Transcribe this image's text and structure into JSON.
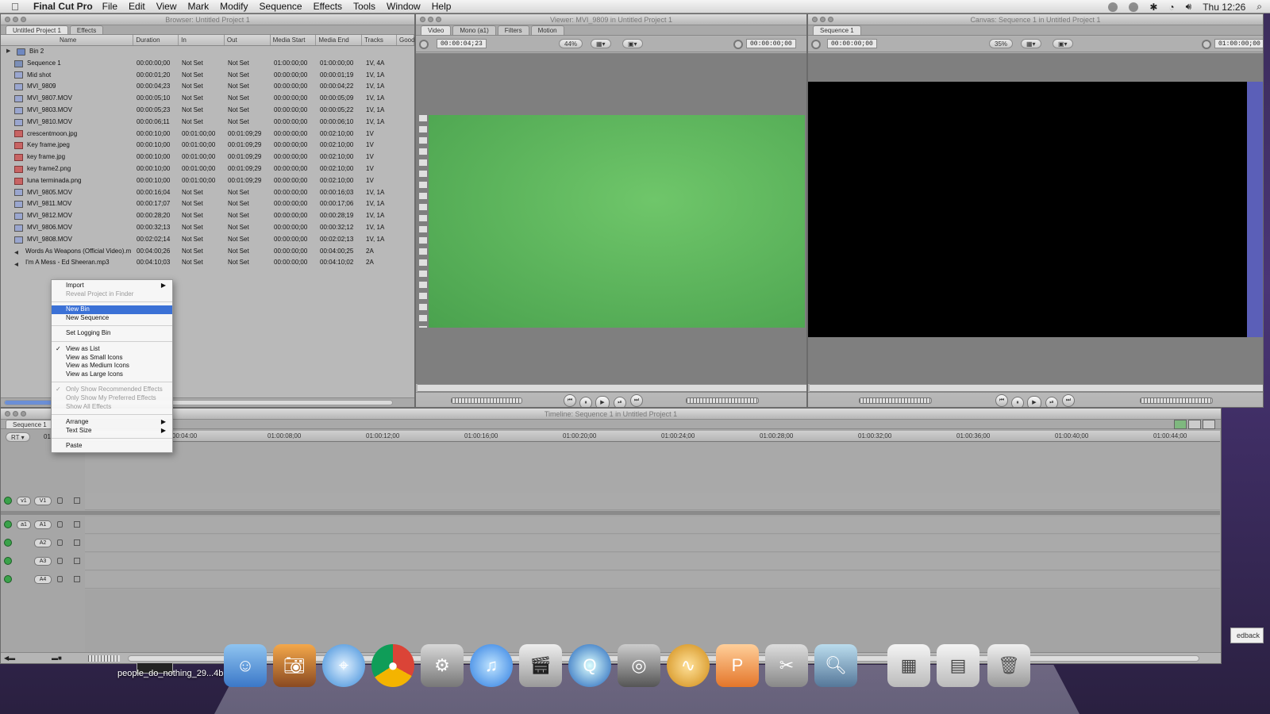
{
  "menubar": {
    "app_name": "Final Cut Pro",
    "menus": [
      "File",
      "Edit",
      "View",
      "Mark",
      "Modify",
      "Sequence",
      "Effects",
      "Tools",
      "Window",
      "Help"
    ],
    "clock": "Thu 12:26"
  },
  "browser": {
    "title": "Browser: Untitled Project 1",
    "tabs": [
      "Untitled Project 1",
      "Effects"
    ],
    "columns": [
      "Name",
      "Duration",
      "In",
      "Out",
      "Media Start",
      "Media End",
      "Tracks",
      "Good"
    ],
    "rows": [
      {
        "name": "Bin 2",
        "type": "bin",
        "duration": "",
        "in": "",
        "out": "",
        "media_start": "",
        "media_end": "",
        "tracks": ""
      },
      {
        "name": "Sequence 1",
        "type": "seq",
        "duration": "00:00:00;00",
        "in": "Not Set",
        "out": "Not Set",
        "media_start": "01:00:00;00",
        "media_end": "01:00:00;00",
        "tracks": "1V, 4A"
      },
      {
        "name": "Mid shot",
        "type": "clip",
        "duration": "00:00:01;20",
        "in": "Not Set",
        "out": "Not Set",
        "media_start": "00:00:00;00",
        "media_end": "00:00:01;19",
        "tracks": "1V, 1A"
      },
      {
        "name": "MVI_9809",
        "type": "clip",
        "duration": "00:00:04;23",
        "in": "Not Set",
        "out": "Not Set",
        "media_start": "00:00:00;00",
        "media_end": "00:00:04;22",
        "tracks": "1V, 1A"
      },
      {
        "name": "MVI_9807.MOV",
        "type": "clip",
        "duration": "00:00:05;10",
        "in": "Not Set",
        "out": "Not Set",
        "media_start": "00:00:00;00",
        "media_end": "00:00:05;09",
        "tracks": "1V, 1A"
      },
      {
        "name": "MVI_9803.MOV",
        "type": "clip",
        "duration": "00:00:05;23",
        "in": "Not Set",
        "out": "Not Set",
        "media_start": "00:00:00;00",
        "media_end": "00:00:05;22",
        "tracks": "1V, 1A"
      },
      {
        "name": "MVI_9810.MOV",
        "type": "clip",
        "duration": "00:00:06;11",
        "in": "Not Set",
        "out": "Not Set",
        "media_start": "00:00:00;00",
        "media_end": "00:00:06;10",
        "tracks": "1V, 1A"
      },
      {
        "name": "crescentmoon.jpg",
        "type": "img",
        "duration": "00:00:10;00",
        "in": "00:01:00;00",
        "out": "00:01:09;29",
        "media_start": "00:00:00;00",
        "media_end": "00:02:10;00",
        "tracks": "1V"
      },
      {
        "name": "Key frame.jpeg",
        "type": "img",
        "duration": "00:00:10;00",
        "in": "00:01:00;00",
        "out": "00:01:09;29",
        "media_start": "00:00:00;00",
        "media_end": "00:02:10;00",
        "tracks": "1V"
      },
      {
        "name": "key frame.jpg",
        "type": "img",
        "duration": "00:00:10;00",
        "in": "00:01:00;00",
        "out": "00:01:09;29",
        "media_start": "00:00:00;00",
        "media_end": "00:02:10;00",
        "tracks": "1V"
      },
      {
        "name": "key frame2.png",
        "type": "img",
        "duration": "00:00:10;00",
        "in": "00:01:00;00",
        "out": "00:01:09;29",
        "media_start": "00:00:00;00",
        "media_end": "00:02:10;00",
        "tracks": "1V"
      },
      {
        "name": "luna terminada.png",
        "type": "img",
        "duration": "00:00:10;00",
        "in": "00:01:00;00",
        "out": "00:01:09;29",
        "media_start": "00:00:00;00",
        "media_end": "00:02:10;00",
        "tracks": "1V"
      },
      {
        "name": "MVI_9805.MOV",
        "type": "clip",
        "duration": "00:00:16;04",
        "in": "Not Set",
        "out": "Not Set",
        "media_start": "00:00:00;00",
        "media_end": "00:00:16;03",
        "tracks": "1V, 1A"
      },
      {
        "name": "MVI_9811.MOV",
        "type": "clip",
        "duration": "00:00:17;07",
        "in": "Not Set",
        "out": "Not Set",
        "media_start": "00:00:00;00",
        "media_end": "00:00:17;06",
        "tracks": "1V, 1A"
      },
      {
        "name": "MVI_9812.MOV",
        "type": "clip",
        "duration": "00:00:28;20",
        "in": "Not Set",
        "out": "Not Set",
        "media_start": "00:00:00;00",
        "media_end": "00:00:28;19",
        "tracks": "1V, 1A"
      },
      {
        "name": "MVI_9806.MOV",
        "type": "clip",
        "duration": "00:00:32;13",
        "in": "Not Set",
        "out": "Not Set",
        "media_start": "00:00:00;00",
        "media_end": "00:00:32;12",
        "tracks": "1V, 1A"
      },
      {
        "name": "MVI_9808.MOV",
        "type": "clip",
        "duration": "00:02:02;14",
        "in": "Not Set",
        "out": "Not Set",
        "media_start": "00:00:00;00",
        "media_end": "00:02:02;13",
        "tracks": "1V, 1A"
      },
      {
        "name": "Words As Weapons (Official Video).m",
        "type": "aud",
        "duration": "00:04:00;26",
        "in": "Not Set",
        "out": "Not Set",
        "media_start": "00:00:00;00",
        "media_end": "00:04:00;25",
        "tracks": "2A"
      },
      {
        "name": "I'm A Mess - Ed Sheeran.mp3",
        "type": "aud",
        "duration": "00:04:10;03",
        "in": "Not Set",
        "out": "Not Set",
        "media_start": "00:00:00;00",
        "media_end": "00:04:10;02",
        "tracks": "2A"
      }
    ]
  },
  "context_menu": {
    "items": [
      {
        "label": "Import",
        "submenu": true
      },
      {
        "label": "Reveal Project in Finder",
        "disabled": true
      },
      {
        "sep": true
      },
      {
        "label": "New Bin",
        "selected": true
      },
      {
        "label": "New Sequence"
      },
      {
        "sep": true
      },
      {
        "label": "Set Logging Bin"
      },
      {
        "sep": true
      },
      {
        "label": "View as List",
        "checked": true
      },
      {
        "label": "View as Small Icons"
      },
      {
        "label": "View as Medium Icons"
      },
      {
        "label": "View as Large Icons"
      },
      {
        "sep": true
      },
      {
        "label": "Only Show Recommended Effects",
        "disabled": true,
        "checked": true
      },
      {
        "label": "Only Show My Preferred Effects",
        "disabled": true
      },
      {
        "label": "Show All Effects",
        "disabled": true
      },
      {
        "sep": true
      },
      {
        "label": "Arrange",
        "submenu": true
      },
      {
        "label": "Text Size",
        "submenu": true
      },
      {
        "sep": true
      },
      {
        "label": "Paste"
      }
    ]
  },
  "viewer": {
    "title": "Viewer: MVI_9809 in Untitled Project 1",
    "tabs": [
      "Video",
      "Mono (a1)",
      "Filters",
      "Motion"
    ],
    "duration_tc": "00:00:04;23",
    "zoom": "44%",
    "current_tc": "00:00:00;00",
    "frame_color": "#5cb85c"
  },
  "canvas": {
    "title": "Canvas: Sequence 1 in Untitled Project 1",
    "tab": "Sequence 1",
    "duration_tc": "00:00:00;00",
    "zoom": "35%",
    "current_tc": "01:00:00;00"
  },
  "timeline": {
    "title": "Timeline: Sequence 1 in Untitled Project 1",
    "tab": "Sequence 1",
    "rt_label": "RT",
    "tc_stub": "01",
    "ruler": [
      "00:04:00",
      "01:00:08;00",
      "01:00:12;00",
      "01:00:16;00",
      "01:00:20;00",
      "01:00:24;00",
      "01:00:28;00",
      "01:00:32;00",
      "01:00:36;00",
      "01:00:40;00",
      "01:00:44;00"
    ],
    "tracks": [
      {
        "src": "v1",
        "dst": "V1"
      },
      {
        "src": "a1",
        "dst": "A1"
      },
      {
        "src": "",
        "dst": "A2"
      },
      {
        "src": "",
        "dst": "A3"
      },
      {
        "src": "",
        "dst": "A4"
      }
    ]
  },
  "desktop": {
    "file_label": "people_do_nothing_29...4b.jpg",
    "feedback_label": "edback"
  }
}
